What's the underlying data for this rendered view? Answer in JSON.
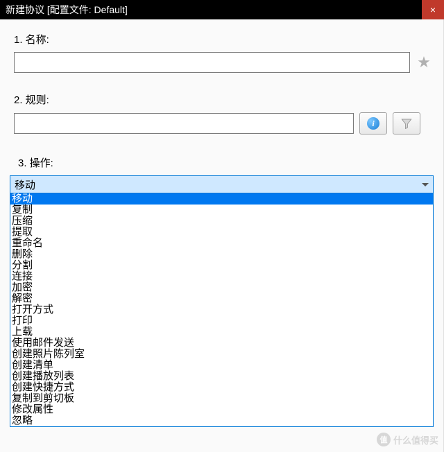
{
  "titlebar": {
    "title": "新建协议 [配置文件: Default]",
    "close": "×"
  },
  "fields": {
    "name": {
      "label": "1.  名称:"
    },
    "rule": {
      "label": "2.  规则:"
    },
    "action": {
      "label": "3.  操作:"
    }
  },
  "buttons": {
    "info_glyph": "i"
  },
  "select": {
    "value": "移动",
    "options": [
      "移动",
      "复制",
      "压缩",
      "提取",
      "重命名",
      "删除",
      "分割",
      "连接",
      "加密",
      "解密",
      "打开方式",
      "打印",
      "上载",
      "使用邮件发送",
      "创建照片陈列室",
      "创建清单",
      "创建播放列表",
      "创建快捷方式",
      "复制到剪切板",
      "修改属性",
      "忽略"
    ],
    "selected_index": 0
  },
  "watermark": {
    "icon": "值",
    "text": "什么值得买"
  }
}
